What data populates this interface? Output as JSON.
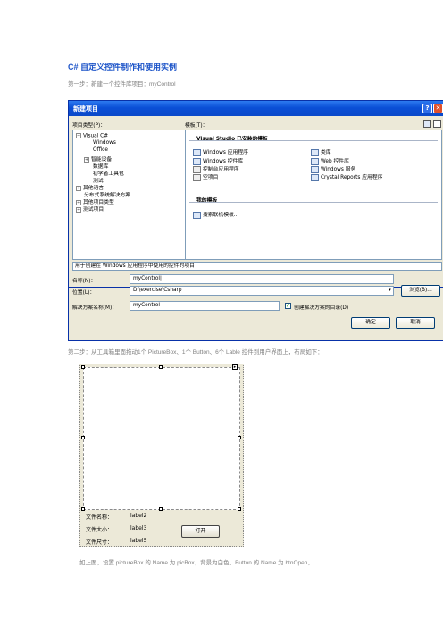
{
  "doc": {
    "title": "C#  自定义控件制作和使用实例",
    "step1": "第一步：新建一个控件库项目：myControl",
    "step2": "第二步：从工具箱里面拖动1个 PictureBox、1个 Button、6个 Lable 控件到用户界面上，布局如下：",
    "step3": "如上图，设置 pictureBox 的 Name 为 picBox，背景为白色，Button 的 Name 为 btnOpen，"
  },
  "dialog": {
    "title": "新建项目",
    "project_types_label": "项目类型(P)：",
    "templates_label": "模板(T)：",
    "tree": {
      "root": "Visual C#",
      "children": [
        "Windows",
        "Office",
        "智能设备",
        "数据库",
        "初学者工具包",
        "测试"
      ],
      "others": [
        "其他语言",
        "分布式系统解决方案",
        "其他项目类型",
        "测试项目"
      ]
    },
    "installed_header": "Visual Studio 已安装的模板",
    "installed_left": [
      "Windows 应用程序",
      "Windows 控件库",
      "控制台应用程序",
      "空项目"
    ],
    "installed_right": [
      "类库",
      "Web 控件库",
      "Windows 服务",
      "Crystal Reports 应用程序"
    ],
    "my_header": "我的模板",
    "my_templates": [
      "搜索联机模板..."
    ],
    "description": "用于创建在 Windows 应用程序中使用的控件的项目",
    "name_label": "名称(N)：",
    "name_value": "myControl|",
    "location_label": "位置(L)：",
    "location_value": "D:\\exercise\\Csharp",
    "browse_label": "浏览(B)...",
    "solution_label": "解决方案名称(M)：",
    "solution_value": "myControl",
    "create_dir_label": "创建解决方案的目录(D)",
    "create_dir_checked": true,
    "ok_label": "确定",
    "cancel_label": "取消"
  },
  "form": {
    "labels": [
      {
        "caption": "文件名称：",
        "value": "label2"
      },
      {
        "caption": "文件大小：",
        "value": "label3"
      },
      {
        "caption": "文件尺寸：",
        "value": "label5"
      }
    ],
    "open_button": "打开"
  },
  "colors": {
    "title_blue": "#1f56c9",
    "xp_titlebar": "#0a4fd6",
    "dialog_face": "#ece9d8",
    "check_green": "#21a121"
  }
}
